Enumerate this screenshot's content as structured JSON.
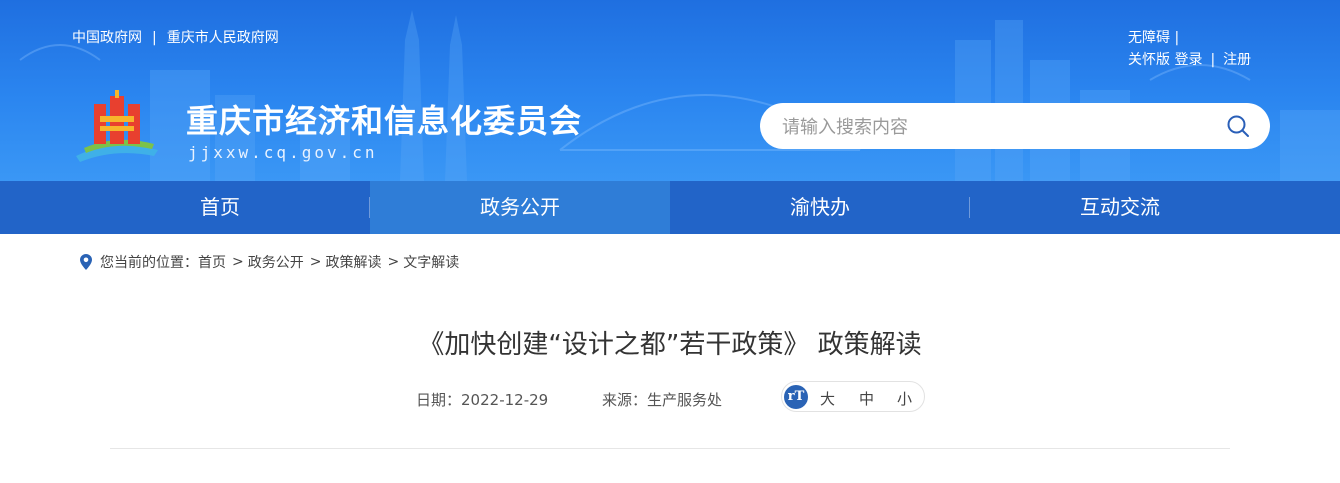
{
  "header": {
    "links_left": [
      "中国政府网",
      "重庆市人民政府网"
    ],
    "links_left_sep": "|",
    "accessibility": "无障碍",
    "elder_mode": "关怀版",
    "login": "登录",
    "register": "注册",
    "sep": "|",
    "title": "重庆市经济和信息化委员会",
    "domain": "jjxxw.cq.gov.cn"
  },
  "search": {
    "placeholder": "请输入搜索内容"
  },
  "nav": {
    "items": [
      {
        "label": "首页",
        "active": false
      },
      {
        "label": "政务公开",
        "active": true
      },
      {
        "label": "渝快办",
        "active": false
      },
      {
        "label": "互动交流",
        "active": false
      }
    ]
  },
  "breadcrumb": {
    "prefix": "您当前的位置：",
    "items": [
      "首页",
      "政务公开",
      "政策解读",
      "文字解读"
    ],
    "sep": ">"
  },
  "article": {
    "title": "《加快创建“设计之都”若干政策》 政策解读",
    "date_label": "日期：",
    "date": "2022-12-29",
    "source_label": "来源：",
    "source": "生产服务处",
    "fontsize_icon": "rT",
    "fontsize_options": [
      "大",
      "中",
      "小"
    ]
  },
  "colors": {
    "header_blue": "#2b86f0",
    "nav_blue": "#2264c8",
    "nav_active": "#2f7dd7",
    "fontsize_icon_bg": "#2a63b5"
  }
}
